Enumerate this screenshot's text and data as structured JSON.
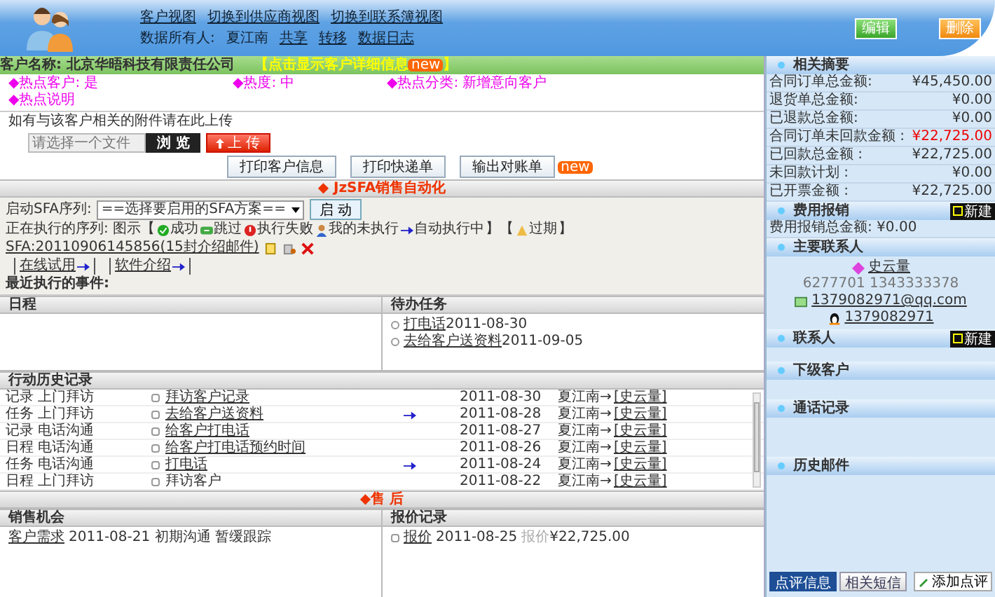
{
  "header": {
    "links": [
      "客户视图",
      "切换到供应商视图",
      "切换到联系簿视图"
    ],
    "owner_label": "数据所有人:",
    "owner": "夏江南",
    "actions": [
      "共享",
      "转移",
      "数据日志"
    ],
    "buttons": [
      {
        "label": "编辑",
        "kind": "edit"
      },
      {
        "label": "删除",
        "kind": "delete"
      }
    ]
  },
  "customer": {
    "name": "客户名称: 北京华晤科技有限责任公司",
    "detail_link": "【点击显示客户详细信息",
    "detail_badge": "new",
    "detail_end": "】"
  },
  "hot_fields": [
    "◆热点客户: 是",
    "◆热度: 中",
    "◆热点分类: 新增意向客户",
    "◆热点说明"
  ],
  "upload": {
    "note": "如有与该客户相关的附件请在此上传",
    "placeholder": "请选择一个文件",
    "browse": "浏 览",
    "upload": "上 传"
  },
  "print_buttons": [
    {
      "label": "打印客户信息"
    },
    {
      "label": "打印快递单"
    },
    {
      "label": "输出对账单",
      "badge": "new"
    }
  ],
  "sfa": {
    "title": "◆ JzSFA销售自动化",
    "start_label": "启动SFA序列:",
    "select": "==选择要启用的SFA方案==",
    "start_button": "启 动",
    "legend": [
      {
        "kind": "text",
        "text": "正在执行的序列: 图示【"
      },
      {
        "kind": "success",
        "text": "成功"
      },
      {
        "kind": "skip",
        "text": "跳过"
      },
      {
        "kind": "fail",
        "text": "执行失败"
      },
      {
        "kind": "pending",
        "text": "我的未执行"
      },
      {
        "kind": "auto",
        "text": "自动执行中"
      },
      {
        "kind": "text",
        "text": "】【"
      },
      {
        "kind": "expired",
        "text": "过期"
      },
      {
        "kind": "text",
        "text": "】"
      }
    ],
    "sequence_link": "SFA:20110906145856(15封介绍邮件)",
    "trial_links": [
      "在线试用",
      "软件介绍"
    ],
    "last_event_label": "最近执行的事件:"
  },
  "schedule": {
    "title": "日程"
  },
  "todo": {
    "title": "待办任务",
    "items": [
      {
        "link": "打电话",
        "date": "2011-08-30"
      },
      {
        "link": "去给客户送资料",
        "date": "2011-09-05"
      }
    ]
  },
  "history": {
    "title": "行动历史记录",
    "rows": [
      {
        "type": "记录 上门拜访",
        "subject": "拜访客户记录",
        "linked": true,
        "auto": false,
        "date": "2011-08-30",
        "owner": "夏江南→",
        "contact": "[史云量]"
      },
      {
        "type": "任务 上门拜访",
        "subject": "去给客户送资料",
        "linked": true,
        "auto": true,
        "date": "2011-08-28",
        "owner": "夏江南→",
        "contact": "[史云量]"
      },
      {
        "type": "记录 电话沟通",
        "subject": "给客户打电话",
        "linked": true,
        "auto": false,
        "date": "2011-08-27",
        "owner": "夏江南→",
        "contact": "[史云量]"
      },
      {
        "type": "日程 电话沟通",
        "subject": "给客户打电话预约时间",
        "linked": true,
        "auto": false,
        "date": "2011-08-26",
        "owner": "夏江南→",
        "contact": "[史云量]"
      },
      {
        "type": "任务 电话沟通",
        "subject": "打电话",
        "linked": true,
        "auto": true,
        "date": "2011-08-24",
        "owner": "夏江南→",
        "contact": "[史云量]"
      },
      {
        "type": "日程 上门拜访",
        "subject": "拜访客户",
        "linked": false,
        "auto": false,
        "date": "2011-08-22",
        "owner": "夏江南→",
        "contact": "[史云量]"
      }
    ]
  },
  "after_sales": {
    "title": "◆售 后"
  },
  "opportunities": {
    "title": "销售机会",
    "items": [
      {
        "link": "客户需求",
        "text": "2011-08-21 初期沟通 暂缓跟踪"
      }
    ]
  },
  "quotes": {
    "title": "报价记录",
    "items": [
      {
        "link": "报价",
        "date": "2011-08-25",
        "label": "报价",
        "amount": "¥22,725.00"
      }
    ]
  },
  "sidebar": {
    "summary": {
      "title": "相关摘要",
      "rows": [
        {
          "label": "合同订单总金额:",
          "value": "¥45,450.00",
          "alert": false
        },
        {
          "label": "退货单总金额:",
          "value": "¥0.00",
          "alert": false
        },
        {
          "label": "已退款总金额:",
          "value": "¥0.00",
          "alert": false
        },
        {
          "label": "合同订单未回款金额 :",
          "value": "¥22,725.00",
          "alert": true
        },
        {
          "label": "已回款总金额 :",
          "value": "¥22,725.00",
          "alert": false
        },
        {
          "label": "未回款计划 :",
          "value": "¥0.00",
          "alert": false
        },
        {
          "label": "已开票金额 :",
          "value": "¥22,725.00",
          "alert": false
        }
      ]
    },
    "expense": {
      "title": "费用报销",
      "new_button": "新建",
      "total": "费用报销总金额: ¥0.00"
    },
    "primary_contact": {
      "title": "主要联系人",
      "name": "史云量",
      "phones": "6277701  1343333378",
      "email": "1379082971@qq.com",
      "qq": "1379082971"
    },
    "contacts": {
      "title": "联系人",
      "new_button": "新建"
    },
    "sections": [
      {
        "title": "下级客户"
      },
      {
        "title": "通话记录"
      },
      {
        "title": "历史邮件"
      }
    ],
    "tabs": [
      {
        "label": "点评信息",
        "selected": true
      },
      {
        "label": "相关短信",
        "selected": false
      }
    ],
    "add_comment": "添加点评"
  }
}
